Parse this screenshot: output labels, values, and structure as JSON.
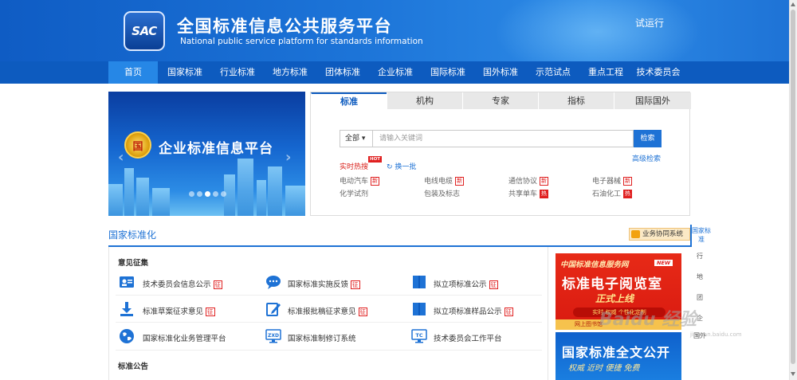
{
  "header": {
    "logo_text": "SAC",
    "title": "全国标准信息公共服务平台",
    "subtitle": "National public service platform  for standards information",
    "trial": "试运行"
  },
  "nav": [
    "首页",
    "国家标准",
    "行业标准",
    "地方标准",
    "团体标准",
    "企业标准",
    "国际标准",
    "国外标准",
    "示范试点",
    "重点工程",
    "技术委员会"
  ],
  "banner": {
    "emblem_text": "国",
    "text": "企业标准信息平台",
    "prev": "‹",
    "next": "›",
    "active_slide": 3,
    "slide_count": 5
  },
  "search": {
    "tabs": [
      "标准",
      "机构",
      "专家",
      "指标",
      "国际国外"
    ],
    "scope": "全部 ▾",
    "placeholder": "请输入关键词",
    "button": "检索",
    "advanced": "高级检索",
    "hot_label": "实时热搜",
    "hot_badge": "HOT",
    "refresh": "换一批",
    "keywords": [
      {
        "text": "电动汽车",
        "badge": "新",
        "badge_type": "new"
      },
      {
        "text": "电线电缆",
        "badge": "新",
        "badge_type": "new"
      },
      {
        "text": "通信协议",
        "badge": "新",
        "badge_type": "new"
      },
      {
        "text": "电子器械",
        "badge": "新",
        "badge_type": "new"
      },
      {
        "text": "化学试剂",
        "badge": "",
        "badge_type": ""
      },
      {
        "text": "包装及标志",
        "badge": "",
        "badge_type": ""
      },
      {
        "text": "共享单车",
        "badge": "热",
        "badge_type": "hot"
      },
      {
        "text": "石油化工",
        "badge": "热",
        "badge_type": "hot"
      }
    ]
  },
  "section": {
    "title": "国家标准化",
    "biz_button": "业务协同系统",
    "opinion_title": "意见征集",
    "notice_title": "标准公告",
    "items": [
      {
        "label": "技术委员会信息公示",
        "badge": "征",
        "icon": "id-card-icon"
      },
      {
        "label": "国家标准实施反馈",
        "badge": "征",
        "icon": "chat-bubble-icon"
      },
      {
        "label": "拟立项标准公示",
        "badge": "征",
        "icon": "book-icon"
      },
      {
        "label": "标准草案征求意见",
        "badge": "征",
        "icon": "download-icon"
      },
      {
        "label": "标准报批稿征求意见",
        "badge": "征",
        "icon": "edit-icon"
      },
      {
        "label": "拟立项标准样品公示",
        "badge": "征",
        "icon": "book-icon"
      },
      {
        "label": "国家标准化业务管理平台",
        "badge": "",
        "icon": "globe-icon"
      },
      {
        "label": "国家标准制修订系统",
        "badge": "",
        "icon": "zxd-monitor-icon"
      },
      {
        "label": "技术委员会工作平台",
        "badge": "",
        "icon": "tc-monitor-icon"
      }
    ],
    "icon_labels": {
      "zxd": "ZXD",
      "tc": "TC"
    }
  },
  "ads": {
    "ad1_head": "中国标准信息服务网",
    "ad1_new": "NEW",
    "ad1_main": "标准电子阅览室",
    "ad1_sub": "正式上线",
    "ad1_tags": "实时  权威  个性化定制",
    "ad1_bottom": "网上图书馆",
    "ad2_main": "国家标准全文公开",
    "ad2_sub": "权威  近时  便捷  免费"
  },
  "side_tabs": [
    "国家标准",
    "行",
    "地",
    "团",
    "企",
    "国外"
  ],
  "watermark": {
    "main": "Baidu 经验",
    "sub": "jingyan.baidu.com"
  },
  "colors": {
    "header_blue": "#1c74d8",
    "nav_blue": "#0d5bbf",
    "nav_active": "#2687e6",
    "accent": "#1e72d5",
    "red": "#e02020"
  }
}
